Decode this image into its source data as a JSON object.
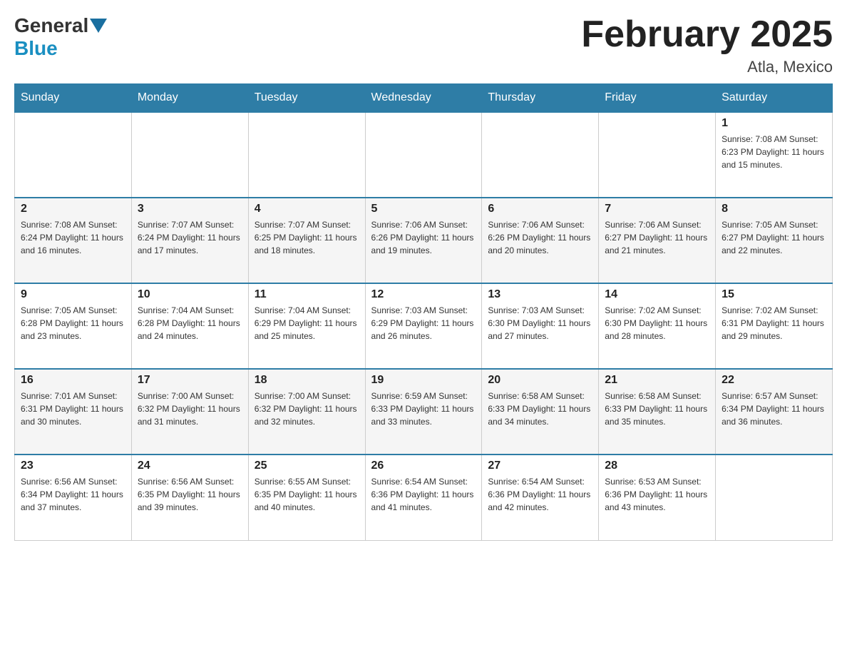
{
  "logo": {
    "general": "General",
    "blue": "Blue"
  },
  "title": "February 2025",
  "location": "Atla, Mexico",
  "headers": [
    "Sunday",
    "Monday",
    "Tuesday",
    "Wednesday",
    "Thursday",
    "Friday",
    "Saturday"
  ],
  "weeks": [
    [
      {
        "day": "",
        "info": ""
      },
      {
        "day": "",
        "info": ""
      },
      {
        "day": "",
        "info": ""
      },
      {
        "day": "",
        "info": ""
      },
      {
        "day": "",
        "info": ""
      },
      {
        "day": "",
        "info": ""
      },
      {
        "day": "1",
        "info": "Sunrise: 7:08 AM\nSunset: 6:23 PM\nDaylight: 11 hours\nand 15 minutes."
      }
    ],
    [
      {
        "day": "2",
        "info": "Sunrise: 7:08 AM\nSunset: 6:24 PM\nDaylight: 11 hours\nand 16 minutes."
      },
      {
        "day": "3",
        "info": "Sunrise: 7:07 AM\nSunset: 6:24 PM\nDaylight: 11 hours\nand 17 minutes."
      },
      {
        "day": "4",
        "info": "Sunrise: 7:07 AM\nSunset: 6:25 PM\nDaylight: 11 hours\nand 18 minutes."
      },
      {
        "day": "5",
        "info": "Sunrise: 7:06 AM\nSunset: 6:26 PM\nDaylight: 11 hours\nand 19 minutes."
      },
      {
        "day": "6",
        "info": "Sunrise: 7:06 AM\nSunset: 6:26 PM\nDaylight: 11 hours\nand 20 minutes."
      },
      {
        "day": "7",
        "info": "Sunrise: 7:06 AM\nSunset: 6:27 PM\nDaylight: 11 hours\nand 21 minutes."
      },
      {
        "day": "8",
        "info": "Sunrise: 7:05 AM\nSunset: 6:27 PM\nDaylight: 11 hours\nand 22 minutes."
      }
    ],
    [
      {
        "day": "9",
        "info": "Sunrise: 7:05 AM\nSunset: 6:28 PM\nDaylight: 11 hours\nand 23 minutes."
      },
      {
        "day": "10",
        "info": "Sunrise: 7:04 AM\nSunset: 6:28 PM\nDaylight: 11 hours\nand 24 minutes."
      },
      {
        "day": "11",
        "info": "Sunrise: 7:04 AM\nSunset: 6:29 PM\nDaylight: 11 hours\nand 25 minutes."
      },
      {
        "day": "12",
        "info": "Sunrise: 7:03 AM\nSunset: 6:29 PM\nDaylight: 11 hours\nand 26 minutes."
      },
      {
        "day": "13",
        "info": "Sunrise: 7:03 AM\nSunset: 6:30 PM\nDaylight: 11 hours\nand 27 minutes."
      },
      {
        "day": "14",
        "info": "Sunrise: 7:02 AM\nSunset: 6:30 PM\nDaylight: 11 hours\nand 28 minutes."
      },
      {
        "day": "15",
        "info": "Sunrise: 7:02 AM\nSunset: 6:31 PM\nDaylight: 11 hours\nand 29 minutes."
      }
    ],
    [
      {
        "day": "16",
        "info": "Sunrise: 7:01 AM\nSunset: 6:31 PM\nDaylight: 11 hours\nand 30 minutes."
      },
      {
        "day": "17",
        "info": "Sunrise: 7:00 AM\nSunset: 6:32 PM\nDaylight: 11 hours\nand 31 minutes."
      },
      {
        "day": "18",
        "info": "Sunrise: 7:00 AM\nSunset: 6:32 PM\nDaylight: 11 hours\nand 32 minutes."
      },
      {
        "day": "19",
        "info": "Sunrise: 6:59 AM\nSunset: 6:33 PM\nDaylight: 11 hours\nand 33 minutes."
      },
      {
        "day": "20",
        "info": "Sunrise: 6:58 AM\nSunset: 6:33 PM\nDaylight: 11 hours\nand 34 minutes."
      },
      {
        "day": "21",
        "info": "Sunrise: 6:58 AM\nSunset: 6:33 PM\nDaylight: 11 hours\nand 35 minutes."
      },
      {
        "day": "22",
        "info": "Sunrise: 6:57 AM\nSunset: 6:34 PM\nDaylight: 11 hours\nand 36 minutes."
      }
    ],
    [
      {
        "day": "23",
        "info": "Sunrise: 6:56 AM\nSunset: 6:34 PM\nDaylight: 11 hours\nand 37 minutes."
      },
      {
        "day": "24",
        "info": "Sunrise: 6:56 AM\nSunset: 6:35 PM\nDaylight: 11 hours\nand 39 minutes."
      },
      {
        "day": "25",
        "info": "Sunrise: 6:55 AM\nSunset: 6:35 PM\nDaylight: 11 hours\nand 40 minutes."
      },
      {
        "day": "26",
        "info": "Sunrise: 6:54 AM\nSunset: 6:36 PM\nDaylight: 11 hours\nand 41 minutes."
      },
      {
        "day": "27",
        "info": "Sunrise: 6:54 AM\nSunset: 6:36 PM\nDaylight: 11 hours\nand 42 minutes."
      },
      {
        "day": "28",
        "info": "Sunrise: 6:53 AM\nSunset: 6:36 PM\nDaylight: 11 hours\nand 43 minutes."
      },
      {
        "day": "",
        "info": ""
      }
    ]
  ]
}
